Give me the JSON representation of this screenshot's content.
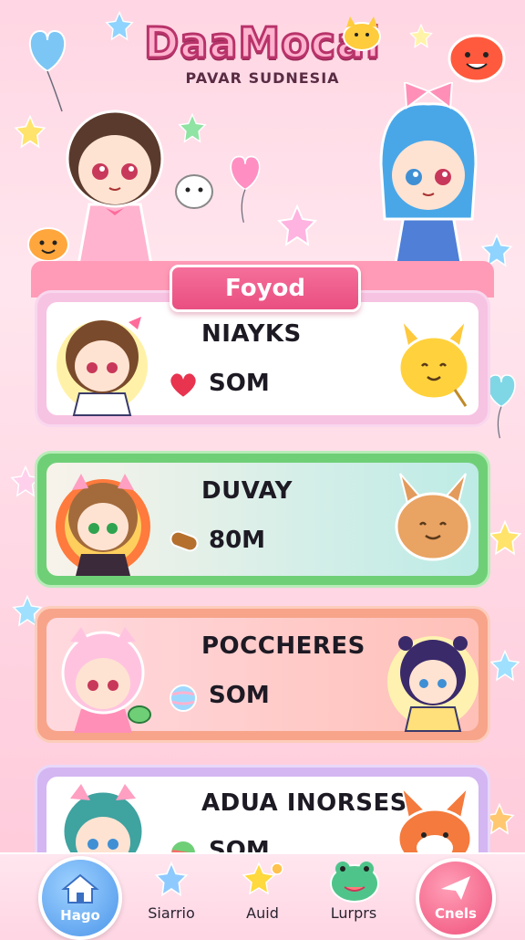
{
  "game": {
    "title": "DaaMocal",
    "subtitle": "PAVAR SUDNESIA"
  },
  "panel": {
    "tab_label": "Foyod"
  },
  "entries": [
    {
      "name": "NIAYKS",
      "amount": "SOM",
      "item_icon": "heart-icon",
      "pet": "yellow-bunny"
    },
    {
      "name": "DUVAY",
      "amount": "80M",
      "item_icon": "bread-icon",
      "pet": "brown-bunny"
    },
    {
      "name": "POCCHERES",
      "amount": "SOM",
      "item_icon": "candy-icon",
      "pet": "chibi-boy"
    },
    {
      "name": "ADUA INORSES",
      "amount": "SOM",
      "item_icon": "ball-icon",
      "pet": "fox"
    }
  ],
  "nav": [
    {
      "label": "Hago",
      "icon": "home-icon"
    },
    {
      "label": "Siarrio",
      "icon": "star-icon"
    },
    {
      "label": "Auid",
      "icon": "stars-icon"
    },
    {
      "label": "Lurprs",
      "icon": "frog-icon"
    },
    {
      "label": "Cnels",
      "icon": "send-icon"
    }
  ],
  "colors": {
    "background": "#ffd6e3",
    "tab": "#e94f81",
    "card1_border": "#f4a9d8",
    "card2_border": "#6fcf77",
    "card3_border": "#f7a48a",
    "card4_border": "#c7a6ee"
  }
}
